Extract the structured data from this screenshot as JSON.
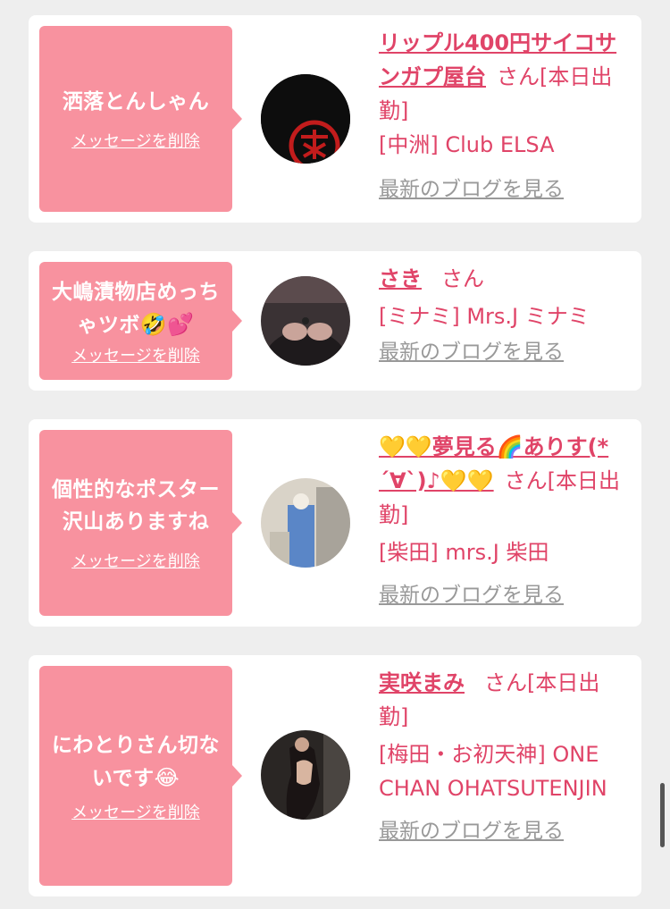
{
  "delete_label": "メッセージを削除",
  "blog_label": "最新のブログを見る",
  "san": "さん",
  "cards": [
    {
      "message": "洒落とんしゃん",
      "name": "リップル400円サイコサンガプ屋台",
      "san_suffix": "さん[本日出勤]",
      "shop": "[中洲] Club ELSA"
    },
    {
      "message_line1": "大嶋漬物店めっち",
      "message_line2": "ゃツボ",
      "message_emoji": "🤣💕",
      "name": "さき",
      "san_suffix": "さん",
      "shop": "[ミナミ] Mrs.J ミナミ"
    },
    {
      "message_line1": "個性的なポスター",
      "message_line2": "沢山ありますね",
      "name": "💛💛夢見る🌈ありす(*´∀`)♪💛💛",
      "san_suffix": "さん[本日出勤]",
      "shop": "[柴田] mrs.J 柴田"
    },
    {
      "message_line1": "にわとりさん切な",
      "message_line2": "いです",
      "message_emoji": "😂",
      "name": "実咲まみ",
      "san_suffix": "さん[本日出勤]",
      "shop": "[梅田・お初天神] ONE CHAN OHATSUTENJIN"
    }
  ],
  "colors": {
    "page_bg": "#eeeeee",
    "card_bg": "#ffffff",
    "bubble_bg": "#f8929f",
    "name_color": "#e04468",
    "blog_link": "#999999"
  }
}
